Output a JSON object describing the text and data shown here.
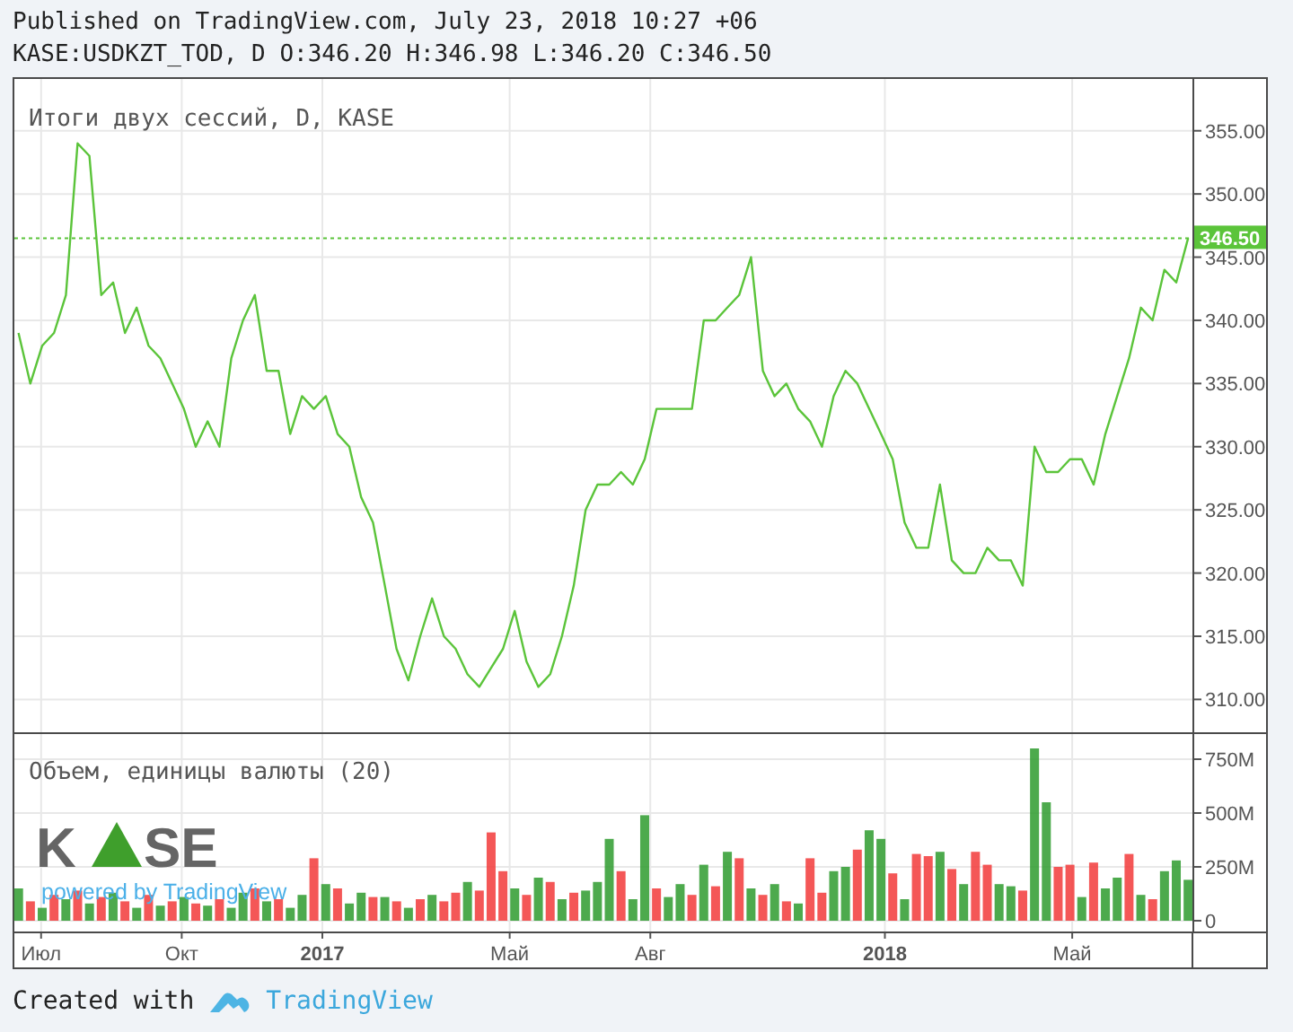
{
  "header": {
    "published": "Published on TradingView.com, July 23, 2018 10:27 +06",
    "symbol_line": "KASE:USDKZT_TOD, D O:346.20 H:346.98 L:346.20 C:346.50"
  },
  "price_pane": {
    "title": "Итоги двух сессий, D, KASE",
    "chart_data": {
      "type": "line",
      "x": [
        2016.46,
        2016.481,
        2016.502,
        2016.523,
        2016.544,
        2016.565,
        2016.586,
        2016.607,
        2016.628,
        2016.649,
        2016.67,
        2016.691,
        2016.712,
        2016.733,
        2016.754,
        2016.775,
        2016.796,
        2016.817,
        2016.838,
        2016.859,
        2016.88,
        2016.901,
        2016.922,
        2016.943,
        2016.964,
        2016.985,
        2017.006,
        2017.027,
        2017.048,
        2017.069,
        2017.09,
        2017.111,
        2017.132,
        2017.153,
        2017.174,
        2017.195,
        2017.216,
        2017.237,
        2017.258,
        2017.279,
        2017.3,
        2017.321,
        2017.342,
        2017.363,
        2017.384,
        2017.405,
        2017.426,
        2017.447,
        2017.468,
        2017.489,
        2017.51,
        2017.531,
        2017.552,
        2017.573,
        2017.594,
        2017.615,
        2017.636,
        2017.657,
        2017.678,
        2017.699,
        2017.72,
        2017.741,
        2017.762,
        2017.783,
        2017.804,
        2017.825,
        2017.846,
        2017.867,
        2017.888,
        2017.909,
        2017.93,
        2017.951,
        2017.972,
        2017.993,
        2018.014,
        2018.035,
        2018.056,
        2018.077,
        2018.098,
        2018.119,
        2018.14,
        2018.161,
        2018.182,
        2018.203,
        2018.224,
        2018.245,
        2018.266,
        2018.287,
        2018.308,
        2018.329,
        2018.35,
        2018.371,
        2018.392,
        2018.413,
        2018.434,
        2018.455,
        2018.476,
        2018.497,
        2018.518,
        2018.539
      ],
      "series": [
        {
          "color": "#5bc43a",
          "values": [
            339,
            335,
            338,
            339,
            342,
            354,
            353,
            342,
            343,
            339,
            341,
            338,
            337,
            335,
            333,
            330,
            332,
            330,
            337,
            340,
            342,
            336,
            336,
            331,
            334,
            333,
            334,
            331,
            330,
            326,
            324,
            319,
            314,
            311.5,
            315,
            318,
            315,
            314,
            312,
            311,
            312.5,
            314,
            317,
            313,
            311,
            312,
            315,
            319,
            325,
            327,
            327,
            328,
            327,
            329,
            333,
            333,
            333,
            333,
            340,
            340,
            341,
            342,
            345,
            336,
            334,
            335,
            333,
            332,
            330,
            334,
            336,
            335,
            333,
            331,
            329,
            324,
            322,
            322,
            327,
            321,
            320,
            320,
            322,
            321,
            321,
            319,
            330,
            328,
            328,
            329,
            329,
            327,
            331,
            334,
            337,
            341,
            340,
            344,
            343,
            346.5
          ]
        }
      ],
      "xlim": [
        2016.4525,
        2018.6776
      ],
      "ylim": [
        307.4,
        359.1
      ],
      "yticks": [
        {
          "value": 310,
          "label": "310.00"
        },
        {
          "value": 315,
          "label": "315.00"
        },
        {
          "value": 320,
          "label": "320.00"
        },
        {
          "value": 325,
          "label": "325.00"
        },
        {
          "value": 330,
          "label": "330.00"
        },
        {
          "value": 335,
          "label": "335.00"
        },
        {
          "value": 340,
          "label": "340.00"
        },
        {
          "value": 345,
          "label": "345.00"
        },
        {
          "value": 350,
          "label": "350.00"
        },
        {
          "value": 355,
          "label": "355.00"
        }
      ],
      "grid": true,
      "ref_lines": [
        {
          "axis": "y",
          "value": 346.5,
          "label": "346.50"
        }
      ]
    }
  },
  "volume_pane": {
    "title": "Объем, единицы валюты (20)",
    "logo": {
      "left": "K",
      "right": "SE"
    },
    "powered_by": "powered by TradingView",
    "chart_data": {
      "type": "bar",
      "stacked": true,
      "x": [
        2016.46,
        2016.481,
        2016.502,
        2016.523,
        2016.544,
        2016.565,
        2016.586,
        2016.607,
        2016.628,
        2016.649,
        2016.67,
        2016.691,
        2016.712,
        2016.733,
        2016.754,
        2016.775,
        2016.796,
        2016.817,
        2016.838,
        2016.859,
        2016.88,
        2016.901,
        2016.922,
        2016.943,
        2016.964,
        2016.985,
        2017.006,
        2017.027,
        2017.048,
        2017.069,
        2017.09,
        2017.111,
        2017.132,
        2017.153,
        2017.174,
        2017.195,
        2017.216,
        2017.237,
        2017.258,
        2017.279,
        2017.3,
        2017.321,
        2017.342,
        2017.363,
        2017.384,
        2017.405,
        2017.426,
        2017.447,
        2017.468,
        2017.489,
        2017.51,
        2017.531,
        2017.552,
        2017.573,
        2017.594,
        2017.615,
        2017.636,
        2017.657,
        2017.678,
        2017.699,
        2017.72,
        2017.741,
        2017.762,
        2017.783,
        2017.804,
        2017.825,
        2017.846,
        2017.867,
        2017.888,
        2017.909,
        2017.93,
        2017.951,
        2017.972,
        2017.993,
        2018.014,
        2018.035,
        2018.056,
        2018.077,
        2018.098,
        2018.119,
        2018.14,
        2018.161,
        2018.182,
        2018.203,
        2018.224,
        2018.245,
        2018.266,
        2018.287,
        2018.308,
        2018.329,
        2018.35,
        2018.371,
        2018.392,
        2018.413,
        2018.434,
        2018.455,
        2018.476,
        2018.497,
        2018.518,
        2018.539
      ],
      "series": [
        {
          "color": "#2e9b2e",
          "values": [
            150,
            null,
            60,
            null,
            100,
            null,
            80,
            null,
            130,
            null,
            60,
            null,
            70,
            null,
            110,
            null,
            70,
            null,
            60,
            130,
            null,
            90,
            null,
            60,
            120,
            null,
            170,
            null,
            80,
            130,
            null,
            110,
            null,
            60,
            null,
            120,
            null,
            null,
            180,
            null,
            null,
            null,
            150,
            null,
            200,
            null,
            100,
            null,
            140,
            180,
            380,
            null,
            100,
            490,
            null,
            110,
            170,
            null,
            260,
            null,
            320,
            null,
            150,
            null,
            170,
            null,
            80,
            null,
            null,
            230,
            250,
            null,
            420,
            380,
            null,
            100,
            null,
            null,
            320,
            null,
            170,
            null,
            null,
            170,
            160,
            null,
            800,
            550,
            null,
            null,
            110,
            null,
            150,
            200,
            null,
            120,
            null,
            230,
            280,
            190
          ]
        },
        {
          "color": "#f23a3a",
          "values": [
            null,
            90,
            null,
            120,
            null,
            140,
            null,
            110,
            null,
            90,
            null,
            120,
            null,
            90,
            null,
            80,
            null,
            100,
            null,
            null,
            150,
            null,
            100,
            null,
            null,
            290,
            null,
            150,
            null,
            null,
            110,
            null,
            90,
            null,
            100,
            null,
            90,
            130,
            null,
            140,
            410,
            230,
            null,
            120,
            null,
            180,
            null,
            130,
            null,
            null,
            null,
            230,
            null,
            null,
            150,
            null,
            null,
            120,
            null,
            160,
            null,
            290,
            null,
            120,
            null,
            90,
            null,
            290,
            130,
            null,
            null,
            330,
            null,
            null,
            220,
            null,
            310,
            300,
            null,
            240,
            null,
            320,
            260,
            null,
            null,
            140,
            null,
            null,
            250,
            260,
            null,
            270,
            null,
            null,
            310,
            null,
            100,
            null,
            null,
            null
          ]
        }
      ],
      "xlim": [
        2016.4525,
        2018.6776
      ],
      "ylim": [
        -50,
        866.7
      ],
      "grid": true,
      "xticks": [
        {
          "value": 2016.5,
          "label": "Июл"
        },
        {
          "value": 2016.75,
          "label": "Окт"
        },
        {
          "value": 2017,
          "label": "2017"
        },
        {
          "value": 2017.333,
          "label": "Май"
        },
        {
          "value": 2017.583,
          "label": "Авг"
        },
        {
          "value": 2018,
          "label": "2018"
        },
        {
          "value": 2018.333,
          "label": "Май"
        }
      ],
      "yticks": [
        {
          "value": 0,
          "label": "0"
        },
        {
          "value": 250,
          "label": "250M"
        },
        {
          "value": 500,
          "label": "500M"
        },
        {
          "value": 750,
          "label": "750M"
        }
      ]
    }
  },
  "footer": {
    "created_with": "Created with",
    "brand": "TradingView"
  }
}
